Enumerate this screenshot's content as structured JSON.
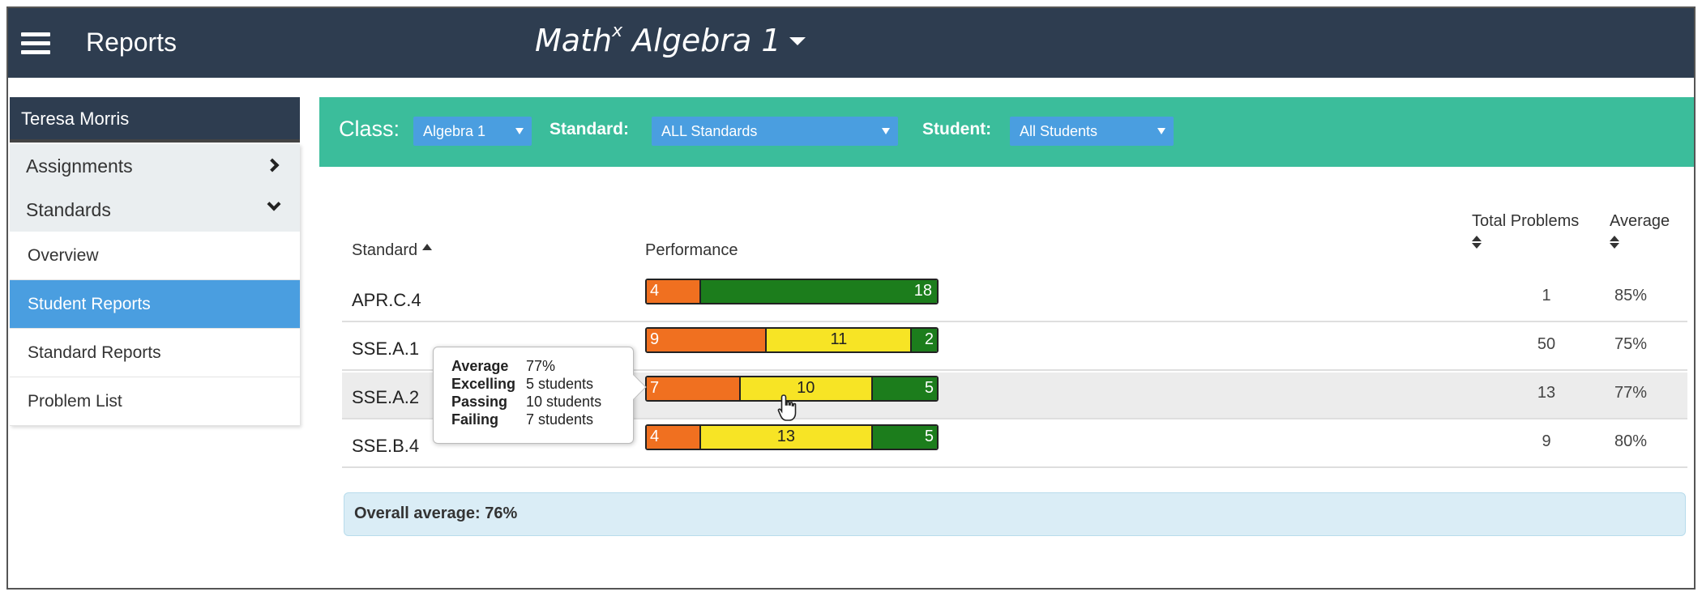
{
  "header": {
    "app_title": "Reports",
    "course_name": "Math",
    "course_superscript": "x",
    "course_suffix": " Algebra 1"
  },
  "sidebar": {
    "user_name": "Teresa Morris",
    "groups": [
      {
        "label": "Assignments"
      },
      {
        "label": "Standards"
      }
    ],
    "items": [
      {
        "label": "Overview"
      },
      {
        "label": "Student Reports"
      },
      {
        "label": "Standard Reports"
      },
      {
        "label": "Problem List"
      }
    ]
  },
  "filters": {
    "class_label": "Class:",
    "class_value": "Algebra 1",
    "standard_label": "Standard:",
    "standard_value": "ALL Standards",
    "student_label": "Student:",
    "student_value": "All Students"
  },
  "table": {
    "headers": {
      "standard": "Standard",
      "performance": "Performance",
      "total": "Total Problems",
      "average": "Average"
    },
    "rows": [
      {
        "standard": "APR.C.4",
        "failing": "4",
        "passing": "",
        "excelling": "18",
        "total": "1",
        "average": "85%"
      },
      {
        "standard": "SSE.A.1",
        "failing": "9",
        "passing": "11",
        "excelling": "2",
        "total": "50",
        "average": "75%"
      },
      {
        "standard": "SSE.A.2",
        "failing": "7",
        "passing": "10",
        "excelling": "5",
        "total": "13",
        "average": "77%"
      },
      {
        "standard": "SSE.B.4",
        "failing": "4",
        "passing": "13",
        "excelling": "5",
        "total": "9",
        "average": "80%"
      }
    ]
  },
  "tooltip": {
    "average_label": "Average",
    "average_value": "77%",
    "excelling_label": "Excelling",
    "excelling_value": "5 students",
    "passing_label": "Passing",
    "passing_value": "10 students",
    "failing_label": "Failing",
    "failing_value": "7 students"
  },
  "summary": {
    "overall": "Overall average: 76%"
  },
  "colors": {
    "header_bg": "#2e3d50",
    "filter_bg": "#3bbd9b",
    "select_bg": "#4a9ee0",
    "failing": "#f07020",
    "passing": "#f7e425",
    "excelling": "#1c7d1c"
  },
  "icons": {
    "menu": "hamburger-icon",
    "sort": "sort-icon",
    "cursor": "hand-pointer-icon"
  }
}
